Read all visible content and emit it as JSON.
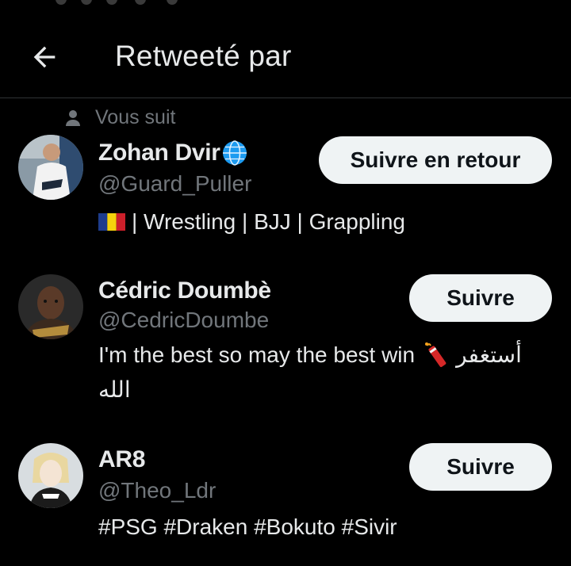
{
  "header": {
    "title": "Retweeté par"
  },
  "users": [
    {
      "social_context": "Vous suit",
      "name": "Zohan Dvir",
      "handle": "@Guard_Puller",
      "bio": "| Wrestling | BJJ | Grappling",
      "button_label": "Suivre en retour"
    },
    {
      "name": "Cédric Doumbè",
      "handle": "@CedricDoumbe",
      "bio_line1": "I'm the best so may the best win",
      "bio_arabic1": "أستغفر",
      "bio_arabic2": "الله",
      "button_label": "Suivre"
    },
    {
      "name": "AR8",
      "handle": "@Theo_Ldr",
      "bio": "#PSG #Draken #Bokuto #Sivir",
      "button_label": "Suivre"
    }
  ],
  "colors": {
    "background": "#000000",
    "primary_text": "#e7e9ea",
    "secondary_text": "#71767b",
    "button_bg": "#eff3f4",
    "button_text": "#0f1419",
    "divider": "#2f3336"
  }
}
